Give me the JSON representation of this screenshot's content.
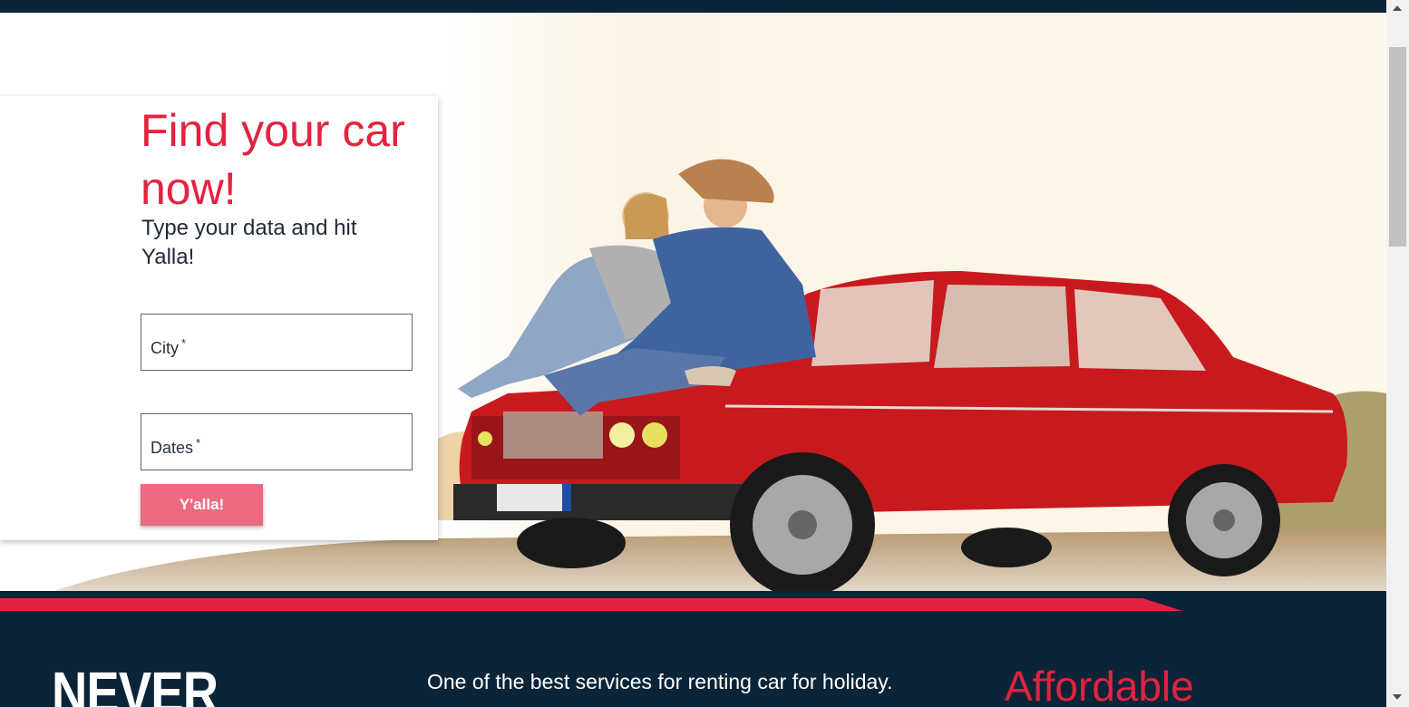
{
  "hero": {
    "title": "Find your car now!",
    "subtitle": "Type your data and hit Yalla!",
    "city_label": "City",
    "dates_label": "Dates",
    "required_mark": "*",
    "submit_label": "Y'alla!"
  },
  "about": {
    "headline": "NEVER",
    "description": "One of the best services for renting car for holiday.",
    "feature_title": "Affordable"
  },
  "colors": {
    "accent": "#e2233f",
    "navy": "#0b2438",
    "button": "#ec6b80"
  }
}
